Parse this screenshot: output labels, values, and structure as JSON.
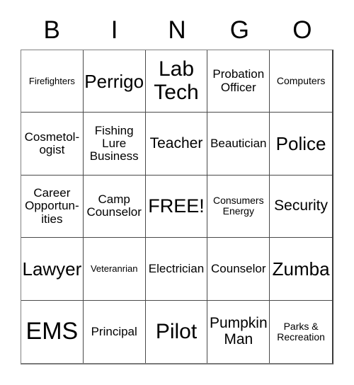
{
  "header": {
    "letters": [
      "B",
      "I",
      "N",
      "G",
      "O"
    ]
  },
  "grid": {
    "rows": 5,
    "columns": 5,
    "cells": [
      {
        "text": "Firefighters",
        "size": "fs-tiny"
      },
      {
        "text": "Perrigo",
        "size": "fs-md"
      },
      {
        "text": "Lab\nTech",
        "size": "fs-lg"
      },
      {
        "text": "Probation\nOfficer",
        "size": "fs-xs"
      },
      {
        "text": "Computers",
        "size": "fs-xxs"
      },
      {
        "text": "Cosmetol-\nogist",
        "size": "fs-xs"
      },
      {
        "text": "Fishing\nLure\nBusiness",
        "size": "fs-xs"
      },
      {
        "text": "Teacher",
        "size": "fs-sm"
      },
      {
        "text": "Beautician",
        "size": "fs-xs"
      },
      {
        "text": "Police",
        "size": "fs-md"
      },
      {
        "text": "Career\nOpportun-\nities",
        "size": "fs-xs"
      },
      {
        "text": "Camp\nCounselor",
        "size": "fs-xs"
      },
      {
        "text": "FREE!",
        "size": "fs-ml"
      },
      {
        "text": "Consumers\nEnergy",
        "size": "fs-xxs"
      },
      {
        "text": "Security",
        "size": "fs-sm"
      },
      {
        "text": "Lawyer",
        "size": "fs-md"
      },
      {
        "text": "Veteranrian",
        "size": "fs-tiny"
      },
      {
        "text": "Electrician",
        "size": "fs-xs"
      },
      {
        "text": "Counselor",
        "size": "fs-xs"
      },
      {
        "text": "Zumba",
        "size": "fs-md"
      },
      {
        "text": "EMS",
        "size": "fs-xl"
      },
      {
        "text": "Principal",
        "size": "fs-xs"
      },
      {
        "text": "Pilot",
        "size": "fs-lg"
      },
      {
        "text": "Pumpkin\nMan",
        "size": "fs-sm"
      },
      {
        "text": "Parks &\nRecreation",
        "size": "fs-xxs"
      }
    ]
  },
  "colors": {
    "background": "#ffffff",
    "text": "#000000",
    "grid_line": "#4a4a4a"
  }
}
